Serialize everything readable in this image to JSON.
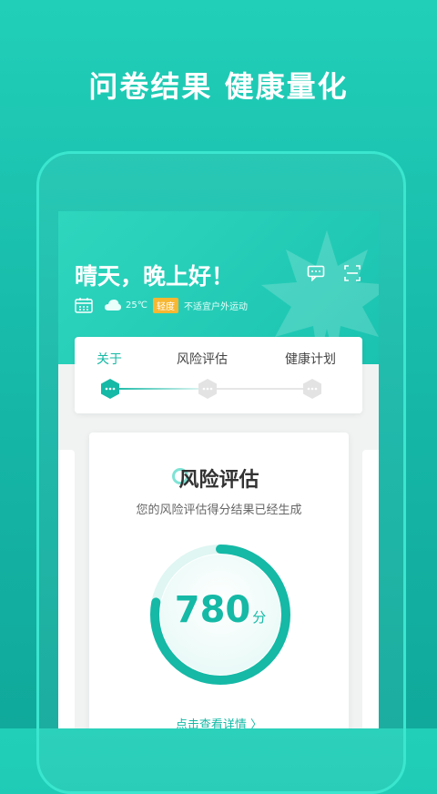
{
  "headline": "问卷结果  健康量化",
  "greeting": "晴天，晚上好！",
  "weather": {
    "temperature": "25℃",
    "air_badge": "轻度",
    "advice": "不适宜户外运动"
  },
  "steps": [
    {
      "label": "关于",
      "active": true
    },
    {
      "label": "风险评估",
      "active": false
    },
    {
      "label": "健康计划",
      "active": false
    }
  ],
  "card": {
    "title": "风险评估",
    "subtitle": "您的风险评估得分结果已经生成",
    "score": "780",
    "unit": "分",
    "score_fraction": 0.78,
    "detail_link": "点击查看详情 〉"
  },
  "colors": {
    "accent": "#15b9a6",
    "badge": "#f7b731",
    "background": "#1fc8b3"
  },
  "icons": [
    "message-icon",
    "scan-icon",
    "calendar-icon",
    "cloud-icon",
    "step-dots-icon",
    "leaf-icon"
  ]
}
